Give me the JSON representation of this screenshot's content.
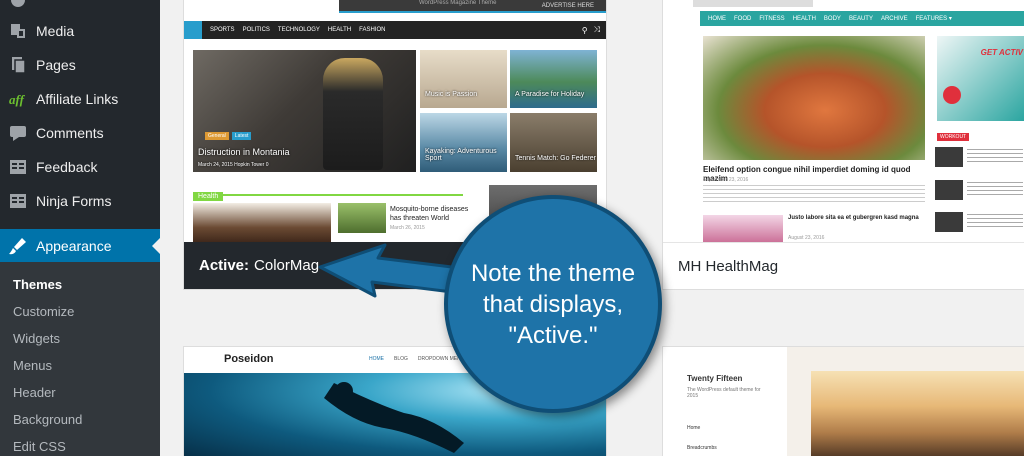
{
  "sidebar": {
    "items": [
      {
        "label": "Media",
        "icon": "media-icon"
      },
      {
        "label": "Pages",
        "icon": "pages-icon"
      },
      {
        "label": "Affiliate Links",
        "icon": "affiliate-links-icon"
      },
      {
        "label": "Comments",
        "icon": "comments-icon"
      },
      {
        "label": "Feedback",
        "icon": "feedback-icon"
      },
      {
        "label": "Ninja Forms",
        "icon": "ninja-forms-icon"
      },
      {
        "label": "Appearance",
        "icon": "appearance-brush-icon"
      }
    ],
    "submenu": [
      "Themes",
      "Customize",
      "Widgets",
      "Menus",
      "Header",
      "Background",
      "Edit CSS"
    ]
  },
  "themes": {
    "colormag": {
      "footer": {
        "prefix": "Active:",
        "name": "ColorMag"
      },
      "nav": [
        "SPORTS",
        "POLITICS",
        "TECHNOLOGY",
        "HEALTH",
        "FASHION"
      ],
      "banner_text": "WordPress Magazine Theme",
      "advertise": "ADVERTISE HERE",
      "posts": {
        "main": "Distruction in Montania",
        "main_meta": "March 24, 2015  Hopkin Tower  0",
        "tags": [
          "General",
          "Latest"
        ],
        "music": "Music is Passion",
        "paradise": "A Paradise for Holiday",
        "kayaking": "Kayaking: Adventurous Sport",
        "tennis": "Tennis Match: Go Federer",
        "mosquito": "Mosquito-borne diseases has threaten World",
        "date": "March 26, 2015"
      },
      "section": "Health"
    },
    "mh_healthmag": {
      "footer": "MH HealthMag",
      "nav": [
        "HOME",
        "FOOD",
        "FITNESS",
        "HEALTH",
        "BODY",
        "BEAUTY",
        "ARCHIVE",
        "FEATURES ▾"
      ],
      "headline": "Eleifend option congue nihil imperdiet doming id quod mazim",
      "headline_date": "September 23, 2016",
      "second_headline": "Justo labore sita ea et gubergren kasd magna",
      "second_meta": "August 23, 2016",
      "workout": "WORKOUT",
      "ad_text": "GET ACTIV"
    },
    "poseidon": {
      "title": "Poseidon",
      "nav": [
        "HOME",
        "BLOG",
        "DROPDOWN MENU ▾"
      ]
    },
    "twentyfifteen": {
      "title": "Twenty Fifteen",
      "tagline": "The WordPress default theme for 2015",
      "menu": [
        "Home",
        "Breadcrumbs"
      ]
    }
  },
  "callout": {
    "lines": [
      "Note the theme",
      "that displays,",
      "\"Active.\""
    ]
  },
  "colors": {
    "accent": "#0073aa",
    "callout": "#1e73a8",
    "sidebar": "#23282d",
    "mh_teal": "#2aa5a0",
    "colormag_blue": "#289dcc"
  }
}
